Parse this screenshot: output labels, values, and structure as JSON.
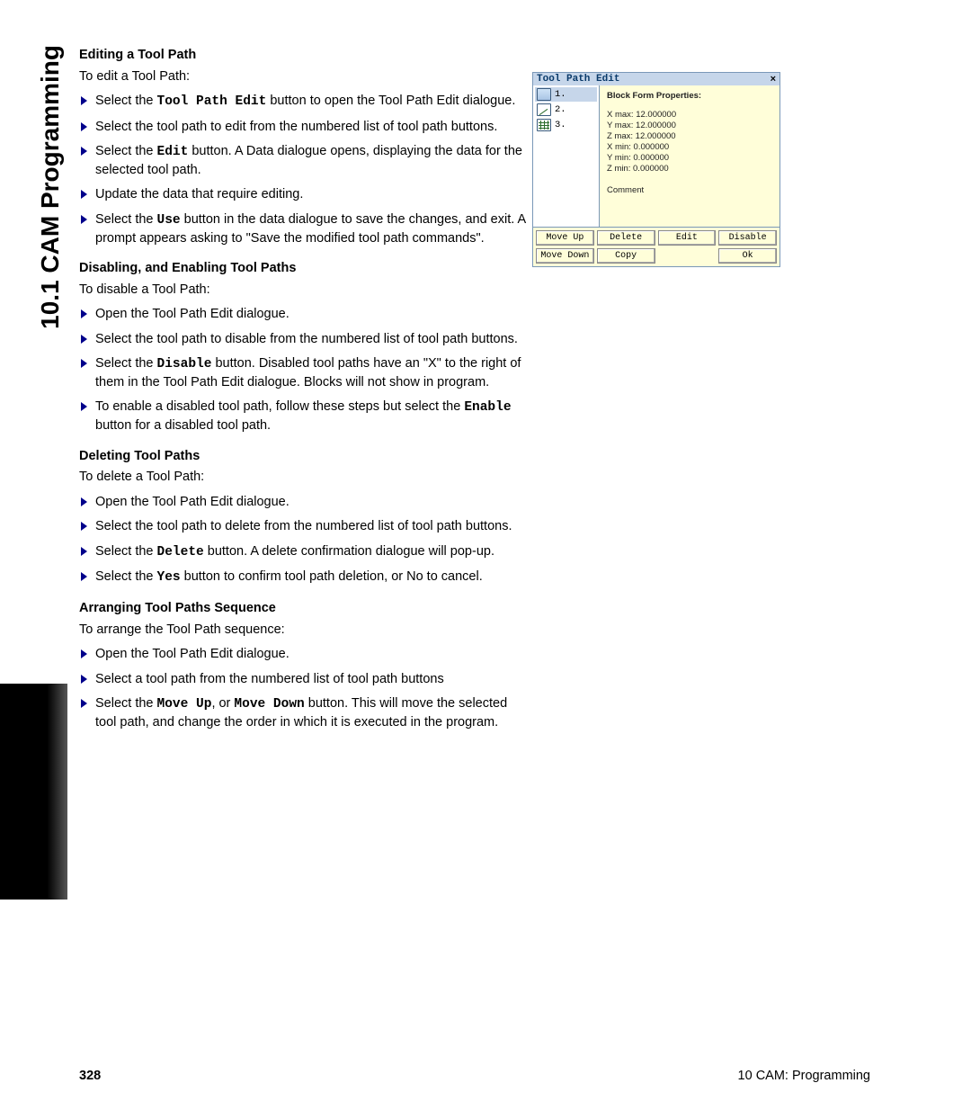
{
  "side_tab": "10.1 CAM Programming",
  "footer": {
    "page": "328",
    "chapter": "10 CAM: Programming"
  },
  "sections": [
    {
      "heading": "Editing a Tool Path",
      "intro": "To edit a Tool Path:",
      "items": [
        {
          "pre": "Select the ",
          "mono": "Tool Path Edit",
          "post": " button to open the Tool Path Edit dialogue."
        },
        {
          "pre": "Select the tool path to edit from the numbered list of tool path buttons.",
          "mono": "",
          "post": ""
        },
        {
          "pre": "Select the ",
          "mono": "Edit",
          "post": " button. A Data dialogue opens, displaying the data for the selected tool path."
        },
        {
          "pre": "Update the data that require editing.",
          "mono": "",
          "post": ""
        },
        {
          "pre": "Select the ",
          "mono": "Use",
          "post": " button in the data dialogue to save the changes, and exit.  A prompt appears asking to \"Save the modified tool path commands\"."
        }
      ]
    },
    {
      "heading": "Disabling, and Enabling Tool Paths",
      "intro": "To disable a Tool Path:",
      "items": [
        {
          "pre": "Open the Tool Path Edit dialogue.",
          "mono": "",
          "post": ""
        },
        {
          "pre": "Select the tool path to disable from the numbered list of tool path buttons.",
          "mono": "",
          "post": ""
        },
        {
          "pre": "Select the ",
          "mono": "Disable",
          "post": " button. Disabled tool paths have an \"X\" to the right of them in the Tool Path Edit dialogue. Blocks will not show in program."
        },
        {
          "pre": "To enable a disabled tool path, follow these steps but select the ",
          "mono": "Enable",
          "post": " button for a disabled tool path."
        }
      ]
    },
    {
      "heading": "Deleting Tool Paths",
      "intro": "To delete a Tool Path:",
      "items": [
        {
          "pre": "Open the Tool Path Edit dialogue.",
          "mono": "",
          "post": ""
        },
        {
          "pre": "Select the tool path to delete from the numbered list of tool path buttons.",
          "mono": "",
          "post": ""
        },
        {
          "pre": "Select the ",
          "mono": "Delete",
          "post": " button. A delete confirmation dialogue will pop-up."
        },
        {
          "pre": "Select the ",
          "mono": "Yes",
          "post": " button to confirm tool path deletion, or No to cancel."
        }
      ]
    },
    {
      "heading": "Arranging Tool Paths Sequence",
      "intro": "To arrange the Tool Path sequence:",
      "items": [
        {
          "pre": "Open the Tool Path Edit dialogue.",
          "mono": "",
          "post": ""
        },
        {
          "pre": "Select a tool path from the numbered list of tool path buttons",
          "mono": "",
          "post": ""
        },
        {
          "pre": "Select the ",
          "mono": "Move Up",
          "mid": ", or ",
          "mono2": "Move Down",
          "post": " button. This will move the selected tool path, and change the order in which it is executed in the program."
        }
      ]
    }
  ],
  "dialog": {
    "title": "Tool Path Edit",
    "close": "×",
    "list": [
      "1.",
      "2.",
      "3."
    ],
    "props_heading": "Block Form Properties:",
    "props": [
      "X max: 12.000000",
      "Y max: 12.000000",
      "Z max: 12.000000",
      "X min: 0.000000",
      "Y min: 0.000000",
      "Z min: 0.000000"
    ],
    "comment_label": "Comment",
    "buttons": [
      "Move Up",
      "Delete",
      "Edit",
      "Disable",
      "Move Down",
      "Copy",
      "",
      "Ok"
    ]
  }
}
